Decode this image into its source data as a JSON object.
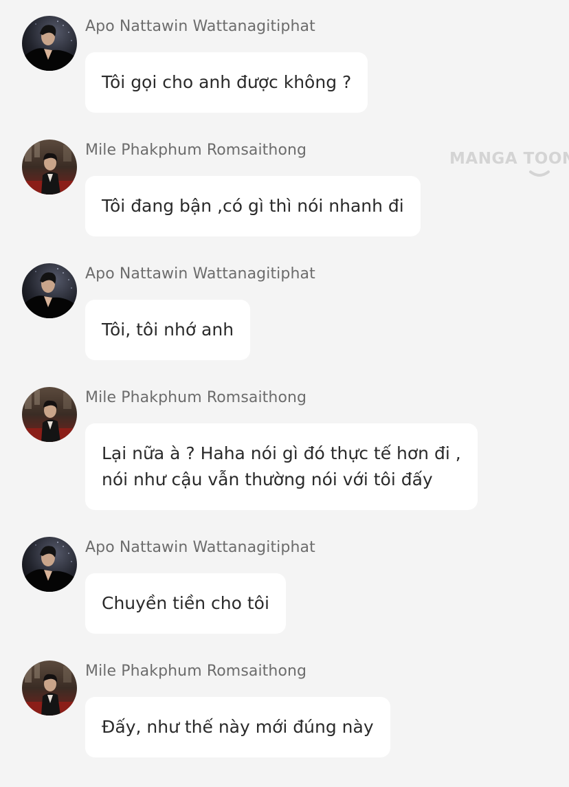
{
  "watermark": {
    "text": "MANGA TOON"
  },
  "messages": [
    {
      "sender": "Apo Nattawin Wattanagitiphat",
      "avatar": "apo-avatar",
      "lines": [
        "Tôi gọi cho anh được không ?"
      ]
    },
    {
      "sender": "Mile Phakphum Romsaithong",
      "avatar": "mile-avatar",
      "lines": [
        "Tôi đang bận ,có gì thì nói nhanh đi"
      ]
    },
    {
      "sender": "Apo Nattawin Wattanagitiphat",
      "avatar": "apo-avatar",
      "lines": [
        "Tôi, tôi nhớ anh"
      ]
    },
    {
      "sender": "Mile Phakphum Romsaithong",
      "avatar": "mile-avatar",
      "lines": [
        "Lại nữa à ? Haha nói gì đó thực tế hơn đi ,",
        "nói như cậu vẫn thường nói với tôi đấy"
      ]
    },
    {
      "sender": "Apo Nattawin Wattanagitiphat",
      "avatar": "apo-avatar",
      "lines": [
        "Chuyền tiền cho tôi"
      ]
    },
    {
      "sender": "Mile Phakphum Romsaithong",
      "avatar": "mile-avatar",
      "lines": [
        "Đấy, như thế này mới đúng này"
      ]
    }
  ],
  "colors": {
    "background": "#f4f4f4",
    "bubble": "#ffffff",
    "sender_text": "#6c6c6c",
    "message_text": "#2a2a2a",
    "watermark": "#d4d4d4"
  }
}
